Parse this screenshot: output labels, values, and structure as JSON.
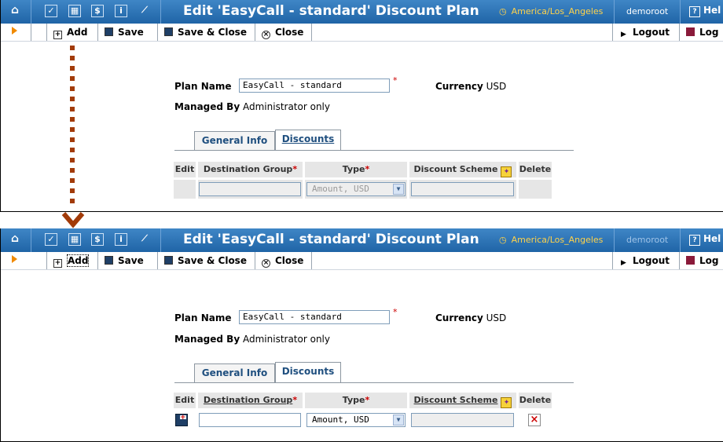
{
  "colors": {
    "titlebar": "#2a74b8",
    "timezone": "#ffd24a",
    "arrow": "#a23b09",
    "required": "#cc0000"
  },
  "titlebar": {
    "icons": [
      "home-icon",
      "checkbox-icon",
      "grid-icon",
      "dollar-icon",
      "info-icon",
      "chart-icon"
    ],
    "title": "Edit 'EasyCall - standard' Discount Plan",
    "timezone": "America/Los_Angeles",
    "user": "demoroot",
    "help": "Hel"
  },
  "toolbar": {
    "add": "Add",
    "save": "Save",
    "save_close": "Save & Close",
    "close": "Close",
    "logout": "Logout",
    "log": "Log"
  },
  "form": {
    "plan_name_label": "Plan Name",
    "plan_name_value": "EasyCall - standard",
    "required_mark": "*",
    "currency_label": "Currency",
    "currency_value": "USD",
    "managed_by_label": "Managed By",
    "managed_by_value": "Administrator only"
  },
  "tabs": {
    "general": "General Info",
    "discounts": "Discounts"
  },
  "table": {
    "col_edit": "Edit",
    "col_destination": "Destination Group",
    "col_type": "Type",
    "col_scheme": "Discount Scheme",
    "col_delete": "Delete",
    "type_value": "Amount, USD",
    "delete_mark": "×"
  }
}
